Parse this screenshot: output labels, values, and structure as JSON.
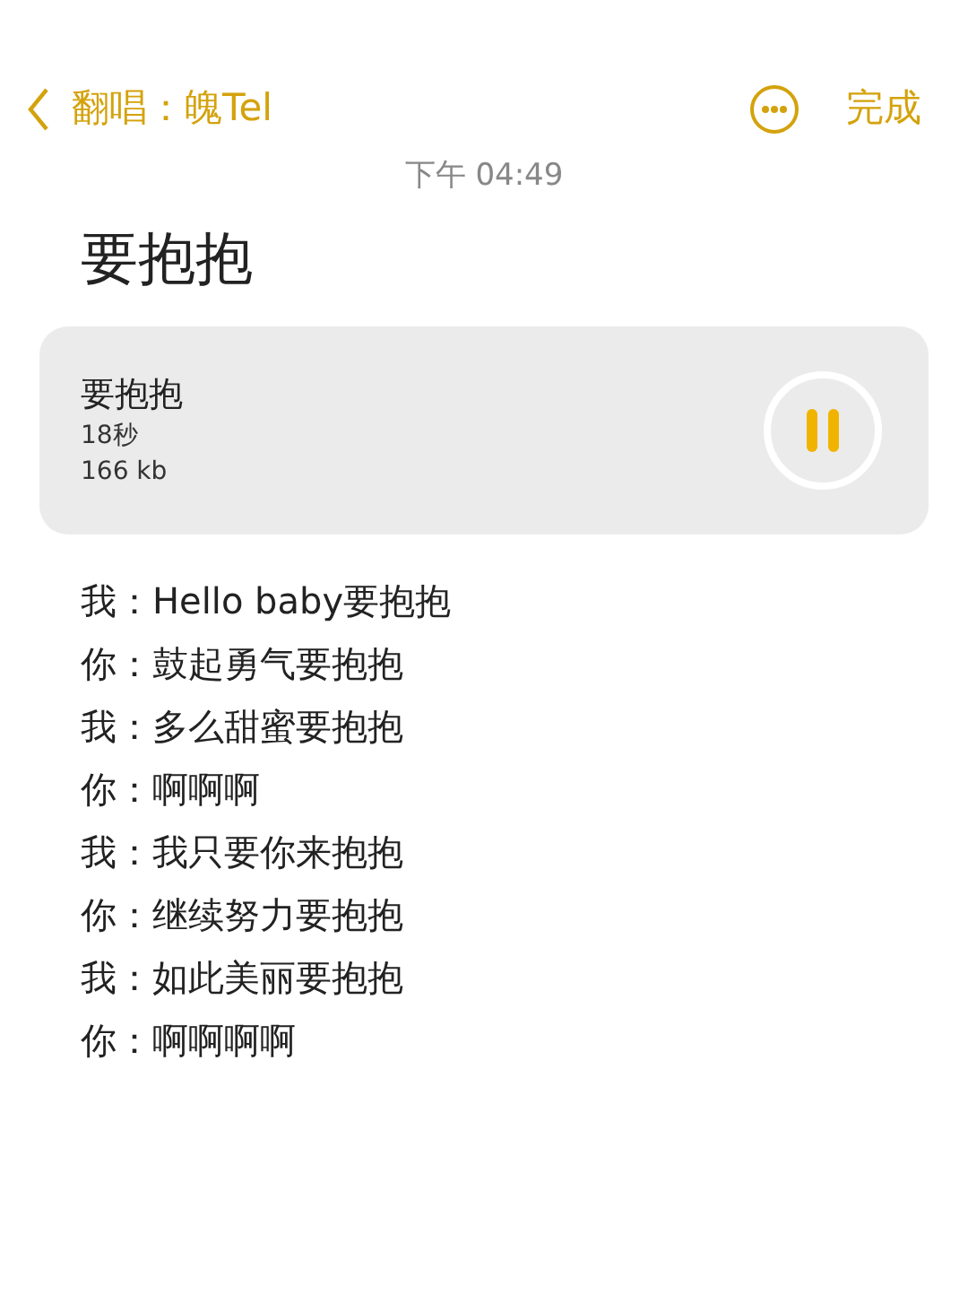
{
  "header": {
    "back_label": "翻唱：魄Tel",
    "done_label": "完成"
  },
  "timestamp": "下午 04:49",
  "title": "要抱抱",
  "audio": {
    "name": "要抱抱",
    "duration": "18秒",
    "size": "166 kb",
    "playing": true
  },
  "lines": [
    "我：Hello baby要抱抱",
    "你：鼓起勇气要抱抱",
    "我：多么甜蜜要抱抱",
    "你：啊啊啊",
    "我：我只要你来抱抱",
    "你：继续努力要抱抱",
    "我：如此美丽要抱抱",
    "你：啊啊啊啊"
  ]
}
